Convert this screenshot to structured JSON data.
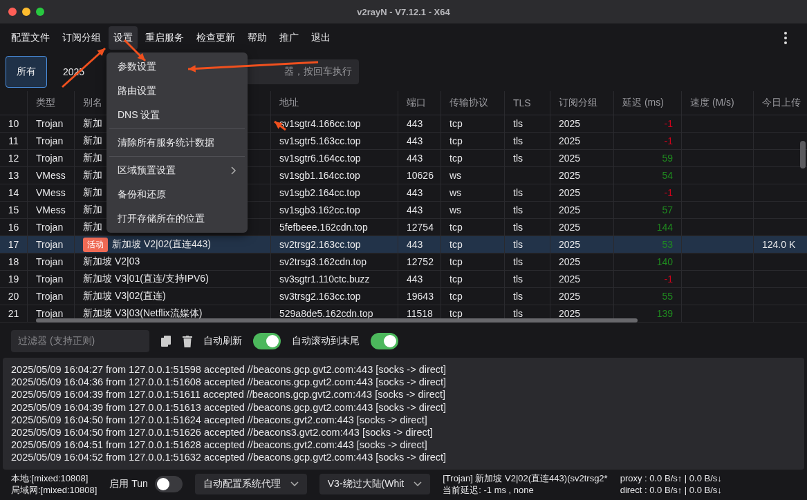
{
  "window": {
    "title": "v2rayN - V7.12.1 - X64"
  },
  "menubar": [
    {
      "label": "配置文件",
      "selected": false
    },
    {
      "label": "订阅分组",
      "selected": false
    },
    {
      "label": "设置",
      "selected": true
    },
    {
      "label": "重启服务",
      "selected": false
    },
    {
      "label": "检查更新",
      "selected": false
    },
    {
      "label": "帮助",
      "selected": false
    },
    {
      "label": "推广",
      "selected": false
    },
    {
      "label": "退出",
      "selected": false
    }
  ],
  "tabs": [
    {
      "label": "所有",
      "selected": true
    },
    {
      "label": "2025",
      "selected": false
    }
  ],
  "search": {
    "placeholder": "器，按回车执行"
  },
  "dropdown_menu": {
    "groups": [
      [
        {
          "label": "参数设置",
          "submenu": false
        },
        {
          "label": "路由设置",
          "submenu": false
        },
        {
          "label": "DNS 设置",
          "submenu": false
        }
      ],
      [
        {
          "label": "清除所有服务统计数据",
          "submenu": false
        }
      ],
      [
        {
          "label": "区域预置设置",
          "submenu": true
        },
        {
          "label": "备份和还原",
          "submenu": false
        },
        {
          "label": "打开存储所在的位置",
          "submenu": false
        }
      ]
    ]
  },
  "table": {
    "columns": [
      "类型",
      "别名",
      "地址",
      "端口",
      "传输协议",
      "TLS",
      "订阅分组",
      "延迟 (ms)",
      "速度 (M/s)",
      "今日上传"
    ],
    "rows": [
      {
        "no": "10",
        "type": "Trojan",
        "alias": "新加",
        "address": "sv1sgtr4.166cc.top",
        "port": "443",
        "transport": "tcp",
        "tls": "tls",
        "group": "2025",
        "delay": "-1",
        "color": "#d0021b",
        "selected": false
      },
      {
        "no": "11",
        "type": "Trojan",
        "alias": "新加",
        "address": "sv1sgtr5.163cc.top",
        "port": "443",
        "transport": "tcp",
        "tls": "tls",
        "group": "2025",
        "delay": "-1",
        "color": "#d0021b",
        "selected": false
      },
      {
        "no": "12",
        "type": "Trojan",
        "alias": "新加",
        "address": "sv1sgtr6.164cc.top",
        "port": "443",
        "transport": "tcp",
        "tls": "tls",
        "group": "2025",
        "delay": "59",
        "color": "#1f8a1f",
        "selected": false
      },
      {
        "no": "13",
        "type": "VMess",
        "alias": "新加",
        "address": "sv1sgb1.164cc.top",
        "port": "10626",
        "transport": "ws",
        "group": "2025",
        "delay": "54",
        "color": "#1f8a1f",
        "selected": false
      },
      {
        "no": "14",
        "type": "VMess",
        "alias": "新加",
        "address": "sv1sgb2.164cc.top",
        "port": "443",
        "transport": "ws",
        "tls": "tls",
        "group": "2025",
        "delay": "-1",
        "color": "#d0021b",
        "selected": false
      },
      {
        "no": "15",
        "type": "VMess",
        "alias": "新加",
        "address": "sv1sgb3.162cc.top",
        "port": "443",
        "transport": "ws",
        "tls": "tls",
        "group": "2025",
        "delay": "57",
        "color": "#1f8a1f",
        "selected": false
      },
      {
        "no": "16",
        "type": "Trojan",
        "alias": "新加",
        "address": "5fefbeee.162cdn.top",
        "port": "12754",
        "transport": "tcp",
        "tls": "tls",
        "group": "2025",
        "delay": "144",
        "color": "#1f8a1f",
        "selected": false
      },
      {
        "no": "17",
        "type": "Trojan",
        "badge": "活动",
        "alias": "新加坡 V2|02(直连443)",
        "address": "sv2trsg2.163cc.top",
        "port": "443",
        "transport": "tcp",
        "tls": "tls",
        "group": "2025",
        "delay": "53",
        "color": "#1f8a1f",
        "upload": "124.0 K",
        "selected": true
      },
      {
        "no": "18",
        "type": "Trojan",
        "alias": "新加坡 V2|03",
        "address": "sv2trsg3.162cdn.top",
        "port": "12752",
        "transport": "tcp",
        "tls": "tls",
        "group": "2025",
        "delay": "140",
        "color": "#1f8a1f",
        "selected": false
      },
      {
        "no": "19",
        "type": "Trojan",
        "alias": "新加坡 V3|01(直连/支持IPV6)",
        "address": "sv3sgtr1.110ctc.buzz",
        "port": "443",
        "transport": "tcp",
        "tls": "tls",
        "group": "2025",
        "delay": "-1",
        "color": "#d0021b",
        "selected": false
      },
      {
        "no": "20",
        "type": "Trojan",
        "alias": "新加坡 V3|02(直连)",
        "address": "sv3trsg2.163cc.top",
        "port": "19643",
        "transport": "tcp",
        "tls": "tls",
        "group": "2025",
        "delay": "55",
        "color": "#1f8a1f",
        "selected": false
      },
      {
        "no": "21",
        "type": "Trojan",
        "alias": "新加坡 V3|03(Netflix流媒体)",
        "address": "529a8de5.162cdn.top",
        "port": "11518",
        "transport": "tcp",
        "tls": "tls",
        "group": "2025",
        "delay": "139",
        "color": "#1f8a1f",
        "selected": false
      }
    ]
  },
  "log_toolbar": {
    "filter": {
      "placeholder": "过滤器 (支持正则)"
    },
    "toggles": [
      {
        "label": "自动刷新",
        "on": true
      },
      {
        "label": "自动滚动到末尾",
        "on": true
      }
    ]
  },
  "log": [
    "2025/05/09 16:04:27 from 127.0.0.1:51598 accepted //beacons.gcp.gvt2.com:443 [socks -> direct]",
    "2025/05/09 16:04:36 from 127.0.0.1:51608 accepted //beacons.gcp.gvt2.com:443 [socks -> direct]",
    "2025/05/09 16:04:39 from 127.0.0.1:51611 accepted //beacons.gcp.gvt2.com:443 [socks -> direct]",
    "2025/05/09 16:04:39 from 127.0.0.1:51613 accepted //beacons.gcp.gvt2.com:443 [socks -> direct]",
    "2025/05/09 16:04:50 from 127.0.0.1:51624 accepted //beacons.gvt2.com:443 [socks -> direct]",
    "2025/05/09 16:04:50 from 127.0.0.1:51626 accepted //beacons3.gvt2.com:443 [socks -> direct]",
    "2025/05/09 16:04:51 from 127.0.0.1:51628 accepted //beacons.gvt2.com:443 [socks -> direct]",
    "2025/05/09 16:04:52 from 127.0.0.1:51632 accepted //beacons.gcp.gvt2.com:443 [socks -> direct]"
  ],
  "status_bar": {
    "ports": [
      "本地:[mixed:10808]",
      "局域网:[mixed:10808]"
    ],
    "tun": {
      "label": "启用 Tun",
      "on": false
    },
    "selects": [
      "自动配置系统代理",
      "V3-绕过大陆(Whit"
    ],
    "server": [
      "[Trojan] 新加坡 V2|02(直连443)(sv2trsg2*",
      "当前延迟: -1 ms , none"
    ],
    "speeds": [
      "proxy : 0.0 B/s↑ | 0.0 B/s↓",
      "direct : 0.0 B/s↑ | 0.0 B/s↓"
    ]
  }
}
